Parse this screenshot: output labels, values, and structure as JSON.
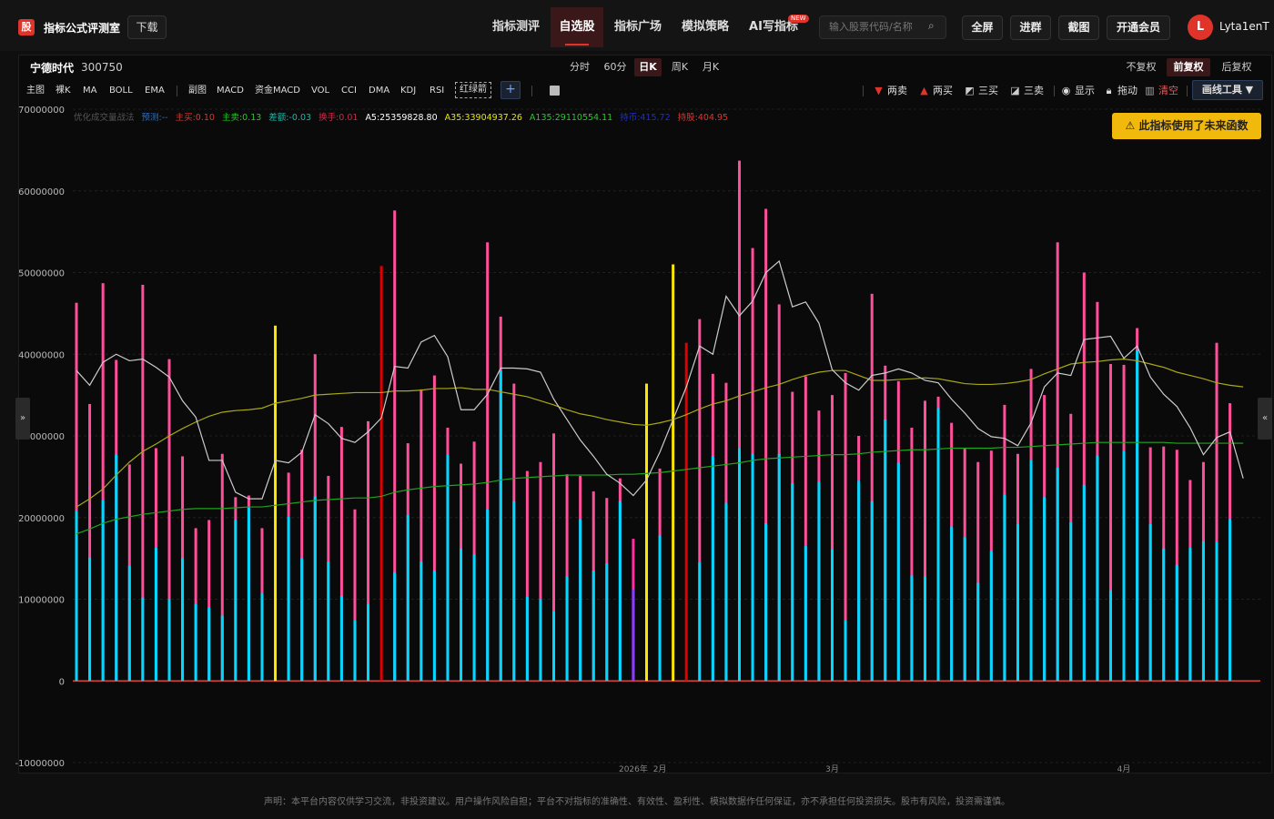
{
  "app": {
    "logo_char": "股",
    "brand": "指标公式评测室",
    "download": "下载",
    "nav": [
      "指标测评",
      "自选股",
      "指标广场",
      "模拟策略",
      "AI写指标"
    ],
    "new_badge": "NEW",
    "search_placeholder": "输入股票代码/名称",
    "buttons": [
      "全屏",
      "进群",
      "截图",
      "开通会员"
    ],
    "avatar_letter": "L",
    "username": "Lyta1enT"
  },
  "stock": {
    "name": "宁德时代",
    "code": "300750"
  },
  "periods": [
    "分时",
    "60分",
    "日K",
    "周K",
    "月K"
  ],
  "active_period": "日K",
  "adjust": [
    "不复权",
    "前复权",
    "后复权"
  ],
  "active_adjust": "前复权",
  "indicators": [
    "主图",
    "裸K",
    "MA",
    "BOLL",
    "EMA",
    "副图",
    "MACD",
    "资金MACD",
    "VOL",
    "CCI",
    "DMA",
    "KDJ",
    "RSI",
    "红绿箭"
  ],
  "draw_tools": [
    "两卖",
    "两买",
    "三买",
    "三卖",
    "显示",
    "拖动",
    "清空"
  ],
  "draw_tool_menu": "画线工具 ▼",
  "warning": "此指标使用了未来函数",
  "legend_items": [
    {
      "text": "优化成交量战法",
      "color": "#555555"
    },
    {
      "text": "预测:--",
      "color": "#2f6fbf"
    },
    {
      "text": "主买:0.10",
      "color": "#e0342b"
    },
    {
      "text": "主卖:0.13",
      "color": "#22cc22"
    },
    {
      "text": "差额:-0.03",
      "color": "#1fb5a5"
    },
    {
      "text": "换手:0.01",
      "color": "#cc2a4a"
    },
    {
      "text": "A5:25359828.80",
      "color": "#ffffff"
    },
    {
      "text": "A35:33904937.26",
      "color": "#e6e600"
    },
    {
      "text": "A135:29110554.11",
      "color": "#22cc22"
    },
    {
      "text": "持币:415.72",
      "color": "#1a2fd8"
    },
    {
      "text": "持股:404.95",
      "color": "#e0342b"
    }
  ],
  "footer": "声明：本平台内容仅供学习交流，非投资建议。用户操作风险自担；平台不对指标的准确性、有效性、盈利性、模拟数据作任何保证，亦不承担任何投资损失。股市有风险，投资需谨慎。",
  "chart_data": {
    "type": "bar",
    "ylim": [
      -10000000,
      70000000
    ],
    "yticks": [
      70000000,
      60000000,
      50000000,
      40000000,
      30000000,
      20000000,
      10000000,
      0,
      -10000000
    ],
    "ytick_labels": [
      "70000000",
      "60000000",
      "50000000",
      "40000000",
      "30000000",
      "20000000",
      "10000000",
      "0",
      "-10000000"
    ],
    "xtick_labels": [
      "2026年",
      "2月",
      "3月",
      "4月"
    ],
    "xtick_bar_index": [
      42,
      44,
      57,
      79
    ],
    "series": [
      {
        "name": "主卖",
        "color": "#00d8ff",
        "values": [
          20800000,
          15100000,
          22100000,
          27700000,
          14100000,
          10200000,
          16300000,
          10000000,
          15000000,
          9400000,
          9000000,
          8000000,
          19700000,
          21300000,
          10700000,
          0,
          20100000,
          15000000,
          22600000,
          14600000,
          10400000,
          7400000,
          9400000,
          0,
          13300000,
          20300000,
          14600000,
          13500000,
          27700000,
          16200000,
          15500000,
          21000000,
          38000000,
          22000000,
          10300000,
          10000000,
          8500000,
          12800000,
          19800000,
          13500000,
          14400000,
          22000000,
          11200000,
          0,
          17800000,
          0,
          0,
          14500000,
          27500000,
          21800000,
          28500000,
          27800000,
          19300000,
          27800000,
          24200000,
          16500000,
          24400000,
          16100000,
          7400000,
          24500000,
          22000000,
          32000000,
          26700000,
          12900000,
          12800000,
          33400000,
          18900000,
          17600000,
          12000000,
          15900000,
          22800000,
          19200000,
          27000000,
          22500000,
          26100000,
          19400000,
          24000000,
          27600000,
          11100000,
          28100000,
          40500000,
          19200000,
          16200000,
          14200000,
          16300000,
          17100000,
          17000000,
          19800000,
          0
        ],
        "xstart": 0
      },
      {
        "name": "总量",
        "color": "#ff4f9a",
        "values": [
          46300000,
          33900000,
          48700000,
          39300000,
          26500000,
          48500000,
          28500000,
          39400000,
          27500000,
          18700000,
          19700000,
          27800000,
          22500000,
          22700000,
          18700000,
          43500000,
          25500000,
          28300000,
          40000000,
          25100000,
          31100000,
          21000000,
          31800000,
          50800000,
          57600000,
          29100000,
          35700000,
          37400000,
          31000000,
          26600000,
          29300000,
          53700000,
          44600000,
          36400000,
          25700000,
          26800000,
          30300000,
          25300000,
          25100000,
          23200000,
          22400000,
          24800000,
          17400000,
          36400000,
          26000000,
          51000000,
          41400000,
          44300000,
          37600000,
          36500000,
          63700000,
          53000000,
          57800000,
          46100000,
          35400000,
          37300000,
          33100000,
          35000000,
          37700000,
          30000000,
          47400000,
          38600000,
          36700000,
          31000000,
          34300000,
          34800000,
          31600000,
          28500000,
          26800000,
          28200000,
          33800000,
          27800000,
          38200000,
          35000000,
          53700000,
          32700000,
          50000000,
          46400000,
          38800000,
          38700000,
          43200000,
          28600000,
          28700000,
          28300000,
          24600000,
          26800000,
          41400000,
          34000000,
          0
        ]
      },
      {
        "name": "A5",
        "color": "#cccccc"
      },
      {
        "name": "A35",
        "color": "#a8a814"
      },
      {
        "name": "A135",
        "color": "#1fa51f"
      }
    ],
    "special_bars": {
      "yellow": [
        15,
        43,
        45
      ],
      "red": [
        23,
        46
      ],
      "purple": [
        42
      ]
    },
    "A5": [
      38000000,
      36200000,
      39000000,
      40000000,
      39200000,
      39400000,
      38400000,
      37200000,
      34300000,
      32300000,
      27000000,
      27000000,
      23100000,
      22300000,
      22300000,
      27000000,
      26700000,
      28000000,
      32600000,
      31500000,
      29700000,
      29200000,
      30500000,
      32200000,
      38500000,
      38300000,
      41500000,
      42300000,
      39700000,
      33200000,
      33200000,
      35100000,
      38300000,
      38300000,
      38200000,
      37800000,
      34500000,
      32000000,
      29500000,
      27500000,
      25300000,
      24200000,
      22700000,
      24600000,
      28000000,
      32000000,
      36000000,
      41000000,
      40000000,
      47100000,
      44700000,
      46500000,
      50000000,
      51400000,
      45800000,
      46400000,
      43800000,
      38100000,
      36500000,
      35600000,
      37400000,
      37700000,
      38200000,
      37700000,
      36800000,
      36500000,
      34500000,
      32800000,
      30900000,
      29900000,
      29700000,
      28800000,
      31600000,
      36000000,
      37700000,
      37400000,
      41800000,
      42000000,
      42200000,
      39500000,
      41000000,
      37200000,
      35100000,
      33600000,
      31000000,
      27700000,
      29800000,
      30500000,
      24800000
    ],
    "A35": [
      21300000,
      22300000,
      23500000,
      25200000,
      26800000,
      28100000,
      29000000,
      30000000,
      30900000,
      31700000,
      32400000,
      32900000,
      33100000,
      33200000,
      33400000,
      34000000,
      34300000,
      34600000,
      35000000,
      35100000,
      35200000,
      35300000,
      35300000,
      35300000,
      35500000,
      35500000,
      35600000,
      35800000,
      35800000,
      35900000,
      35700000,
      35700000,
      35400000,
      35100000,
      34800000,
      34300000,
      33800000,
      33200000,
      32700000,
      32400000,
      32000000,
      31700000,
      31400000,
      31300000,
      31600000,
      32000000,
      32600000,
      33300000,
      33900000,
      34300000,
      34900000,
      35400000,
      35900000,
      36300000,
      36900000,
      37400000,
      37800000,
      38000000,
      38000000,
      37400000,
      36800000,
      36800000,
      36900000,
      37000000,
      37100000,
      37000000,
      36700000,
      36400000,
      36300000,
      36300000,
      36400000,
      36600000,
      36900000,
      37600000,
      38200000,
      38800000,
      39000000,
      39100000,
      39300000,
      39400000,
      39200000,
      38800000,
      38400000,
      37800000,
      37400000,
      37000000,
      36500000,
      36200000,
      36000000
    ],
    "A135": [
      18000000,
      18600000,
      19300000,
      19800000,
      20100000,
      20400000,
      20600000,
      20800000,
      21000000,
      21100000,
      21100000,
      21100000,
      21200000,
      21300000,
      21300000,
      21500000,
      21700000,
      21900000,
      22100000,
      22200000,
      22300000,
      22400000,
      22400000,
      22600000,
      23100000,
      23400000,
      23600000,
      23800000,
      23900000,
      24000000,
      24100000,
      24300000,
      24600000,
      24800000,
      24900000,
      25000000,
      25100000,
      25200000,
      25200000,
      25200000,
      25200000,
      25300000,
      25300000,
      25400000,
      25500000,
      25700000,
      25900000,
      26100000,
      26300000,
      26500000,
      26700000,
      27000000,
      27200000,
      27300000,
      27400000,
      27500000,
      27600000,
      27700000,
      27700000,
      27800000,
      28000000,
      28100000,
      28200000,
      28300000,
      28300000,
      28400000,
      28500000,
      28500000,
      28500000,
      28500000,
      28600000,
      28600000,
      28700000,
      28800000,
      28900000,
      29000000,
      29100000,
      29200000,
      29200000,
      29200000,
      29200000,
      29200000,
      29200000,
      29100000,
      29100000,
      29100000,
      29100000,
      29100000,
      29100000
    ]
  }
}
